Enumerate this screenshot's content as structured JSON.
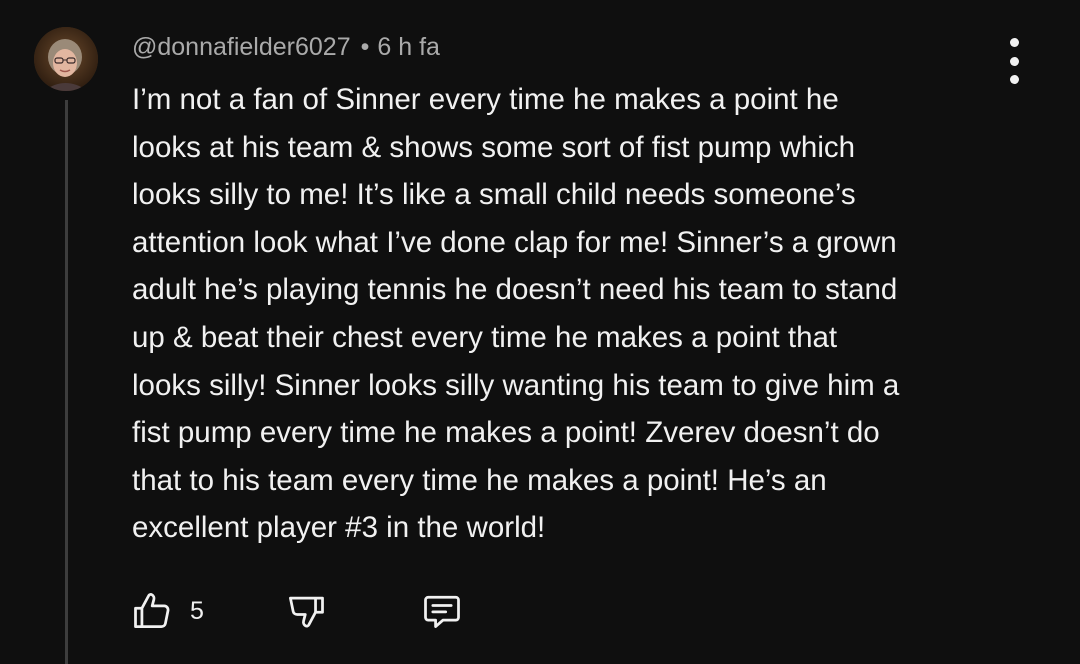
{
  "comment": {
    "author": "@donnafielder6027",
    "separator": "•",
    "time": "6 h fa",
    "body_lines": [
      "I’m not a fan of Sinner every time he makes a point he",
      "looks at his team & shows some sort of fist pump which",
      "looks silly to me! It’s like a small child needs someone’s",
      "attention look what I’ve done clap for me! Sinner’s a grown",
      "adult he’s playing tennis he doesn’t need his team to stand",
      "up & beat their chest every time he makes a point that",
      "looks silly! Sinner looks silly wanting his team to give him a",
      "fist pump every time he makes a point! Zverev doesn’t do",
      "that to his team every time he makes a point! He’s an",
      "excellent player #3 in the world!"
    ],
    "like_count": "5"
  },
  "icons": {
    "more": "more-vert-icon",
    "like": "thumbs-up-icon",
    "dislike": "thumbs-down-icon",
    "reply": "comment-reply-icon"
  },
  "colors": {
    "background": "#0f0f0f",
    "text": "#f1f1f1",
    "meta": "#aaaaaa",
    "thread_line": "#3d3d3d"
  }
}
